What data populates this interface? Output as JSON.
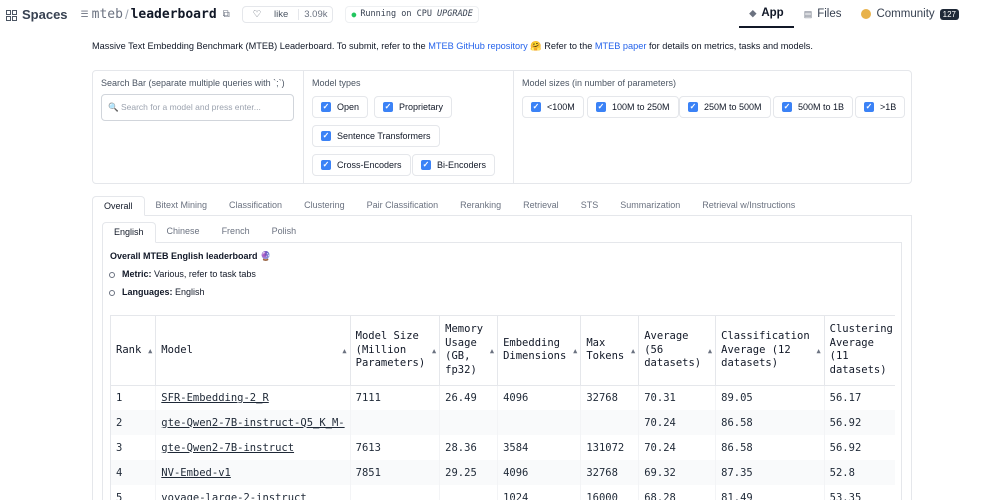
{
  "topbar": {
    "brand": "Spaces",
    "owner": "mteb",
    "repo": "leaderboard",
    "like_label": "like",
    "like_count": "3.09k",
    "running_prefix": "Running on",
    "hardware": "CPU",
    "upgrade": "UPGRADE",
    "tabs": [
      {
        "label": "App",
        "icon": "app-icon"
      },
      {
        "label": "Files",
        "icon": "files-icon"
      },
      {
        "label": "Community",
        "icon": "community-icon",
        "count": "127"
      }
    ]
  },
  "description": {
    "text1": "Massive Text Embedding Benchmark (MTEB) Leaderboard. To submit, refer to the ",
    "link1": "MTEB GitHub repository",
    "text2": " 🤗 Refer to the ",
    "link2": "MTEB paper",
    "text3": " for details on metrics, tasks and models."
  },
  "filters": {
    "search_label": "Search Bar (separate multiple queries with `;`)",
    "search_placeholder": "🔍 Search for a model and press enter...",
    "model_types_label": "Model types",
    "model_types": [
      "Open",
      "Proprietary",
      "Sentence Transformers",
      "Cross-Encoders",
      "Bi-Encoders"
    ],
    "model_sizes_label": "Model sizes (in number of parameters)",
    "model_sizes": [
      "<100M",
      "100M to 250M",
      "250M to 500M",
      "500M to 1B",
      ">1B"
    ]
  },
  "main_tabs": [
    "Overall",
    "Bitext Mining",
    "Classification",
    "Clustering",
    "Pair Classification",
    "Reranking",
    "Retrieval",
    "STS",
    "Summarization",
    "Retrieval w/Instructions"
  ],
  "lang_tabs": [
    "English",
    "Chinese",
    "French",
    "Polish"
  ],
  "overview": {
    "title": "Overall MTEB English leaderboard 🔮",
    "metric_key": "Metric:",
    "metric_val": " Various, refer to task tabs",
    "lang_key": "Languages:",
    "lang_val": " English"
  },
  "table": {
    "headers": [
      "Rank",
      "Model",
      "Model Size (Million Parameters)",
      "Memory Usage (GB, fp32)",
      "Embedding Dimensions",
      "Max Tokens",
      "Average (56 datasets)",
      "Classification Average (12 datasets)",
      "Clustering Average (11 datasets)"
    ],
    "rows": [
      [
        "1",
        "SFR-Embedding-2_R",
        "7111",
        "26.49",
        "4096",
        "32768",
        "70.31",
        "89.05",
        "56.17"
      ],
      [
        "2",
        "gte-Qwen2-7B-instruct-Q5_K_M-",
        "",
        "",
        "",
        "",
        "70.24",
        "86.58",
        "56.92"
      ],
      [
        "3",
        "gte-Qwen2-7B-instruct",
        "7613",
        "28.36",
        "3584",
        "131072",
        "70.24",
        "86.58",
        "56.92"
      ],
      [
        "4",
        "NV-Embed-v1",
        "7851",
        "29.25",
        "4096",
        "32768",
        "69.32",
        "87.35",
        "52.8"
      ],
      [
        "5",
        "voyage-large-2-instruct",
        "",
        "",
        "1024",
        "16000",
        "68.28",
        "81.49",
        "53.35"
      ]
    ]
  }
}
